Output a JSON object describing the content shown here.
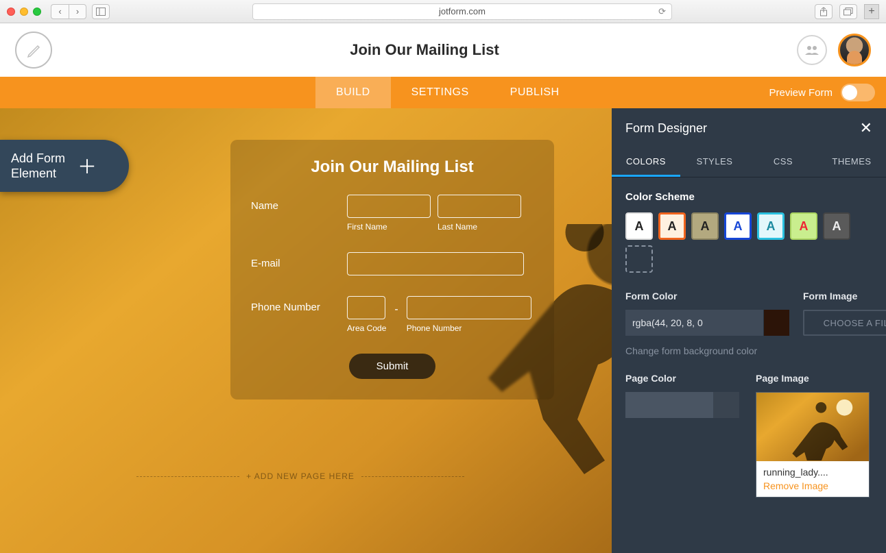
{
  "browser": {
    "url": "jotform.com"
  },
  "header": {
    "title": "Join Our Mailing List"
  },
  "tabs": {
    "items": [
      "BUILD",
      "SETTINGS",
      "PUBLISH"
    ],
    "preview_label": "Preview Form"
  },
  "add_element": {
    "label": "Add Form\nElement"
  },
  "form": {
    "heading": "Join Our Mailing List",
    "name_label": "Name",
    "first_name_sub": "First Name",
    "last_name_sub": "Last Name",
    "email_label": "E-mail",
    "phone_label": "Phone Number",
    "area_sub": "Area Code",
    "phone_sub": "Phone Number",
    "submit": "Submit"
  },
  "add_page": "+ ADD NEW PAGE HERE",
  "designer": {
    "title": "Form Designer",
    "tabs": [
      "COLORS",
      "STYLES",
      "CSS",
      "THEMES"
    ],
    "color_scheme_label": "Color Scheme",
    "swatch_letter": "A",
    "form_color_label": "Form Color",
    "form_color_value": "rgba(44, 20, 8, 0",
    "form_color_helper": "Change form background color",
    "form_image_label": "Form Image",
    "choose_file": "CHOOSE A FILE",
    "page_color_label": "Page Color",
    "page_image_label": "Page Image",
    "page_image_name": "running_lady....",
    "remove_image": "Remove Image"
  }
}
